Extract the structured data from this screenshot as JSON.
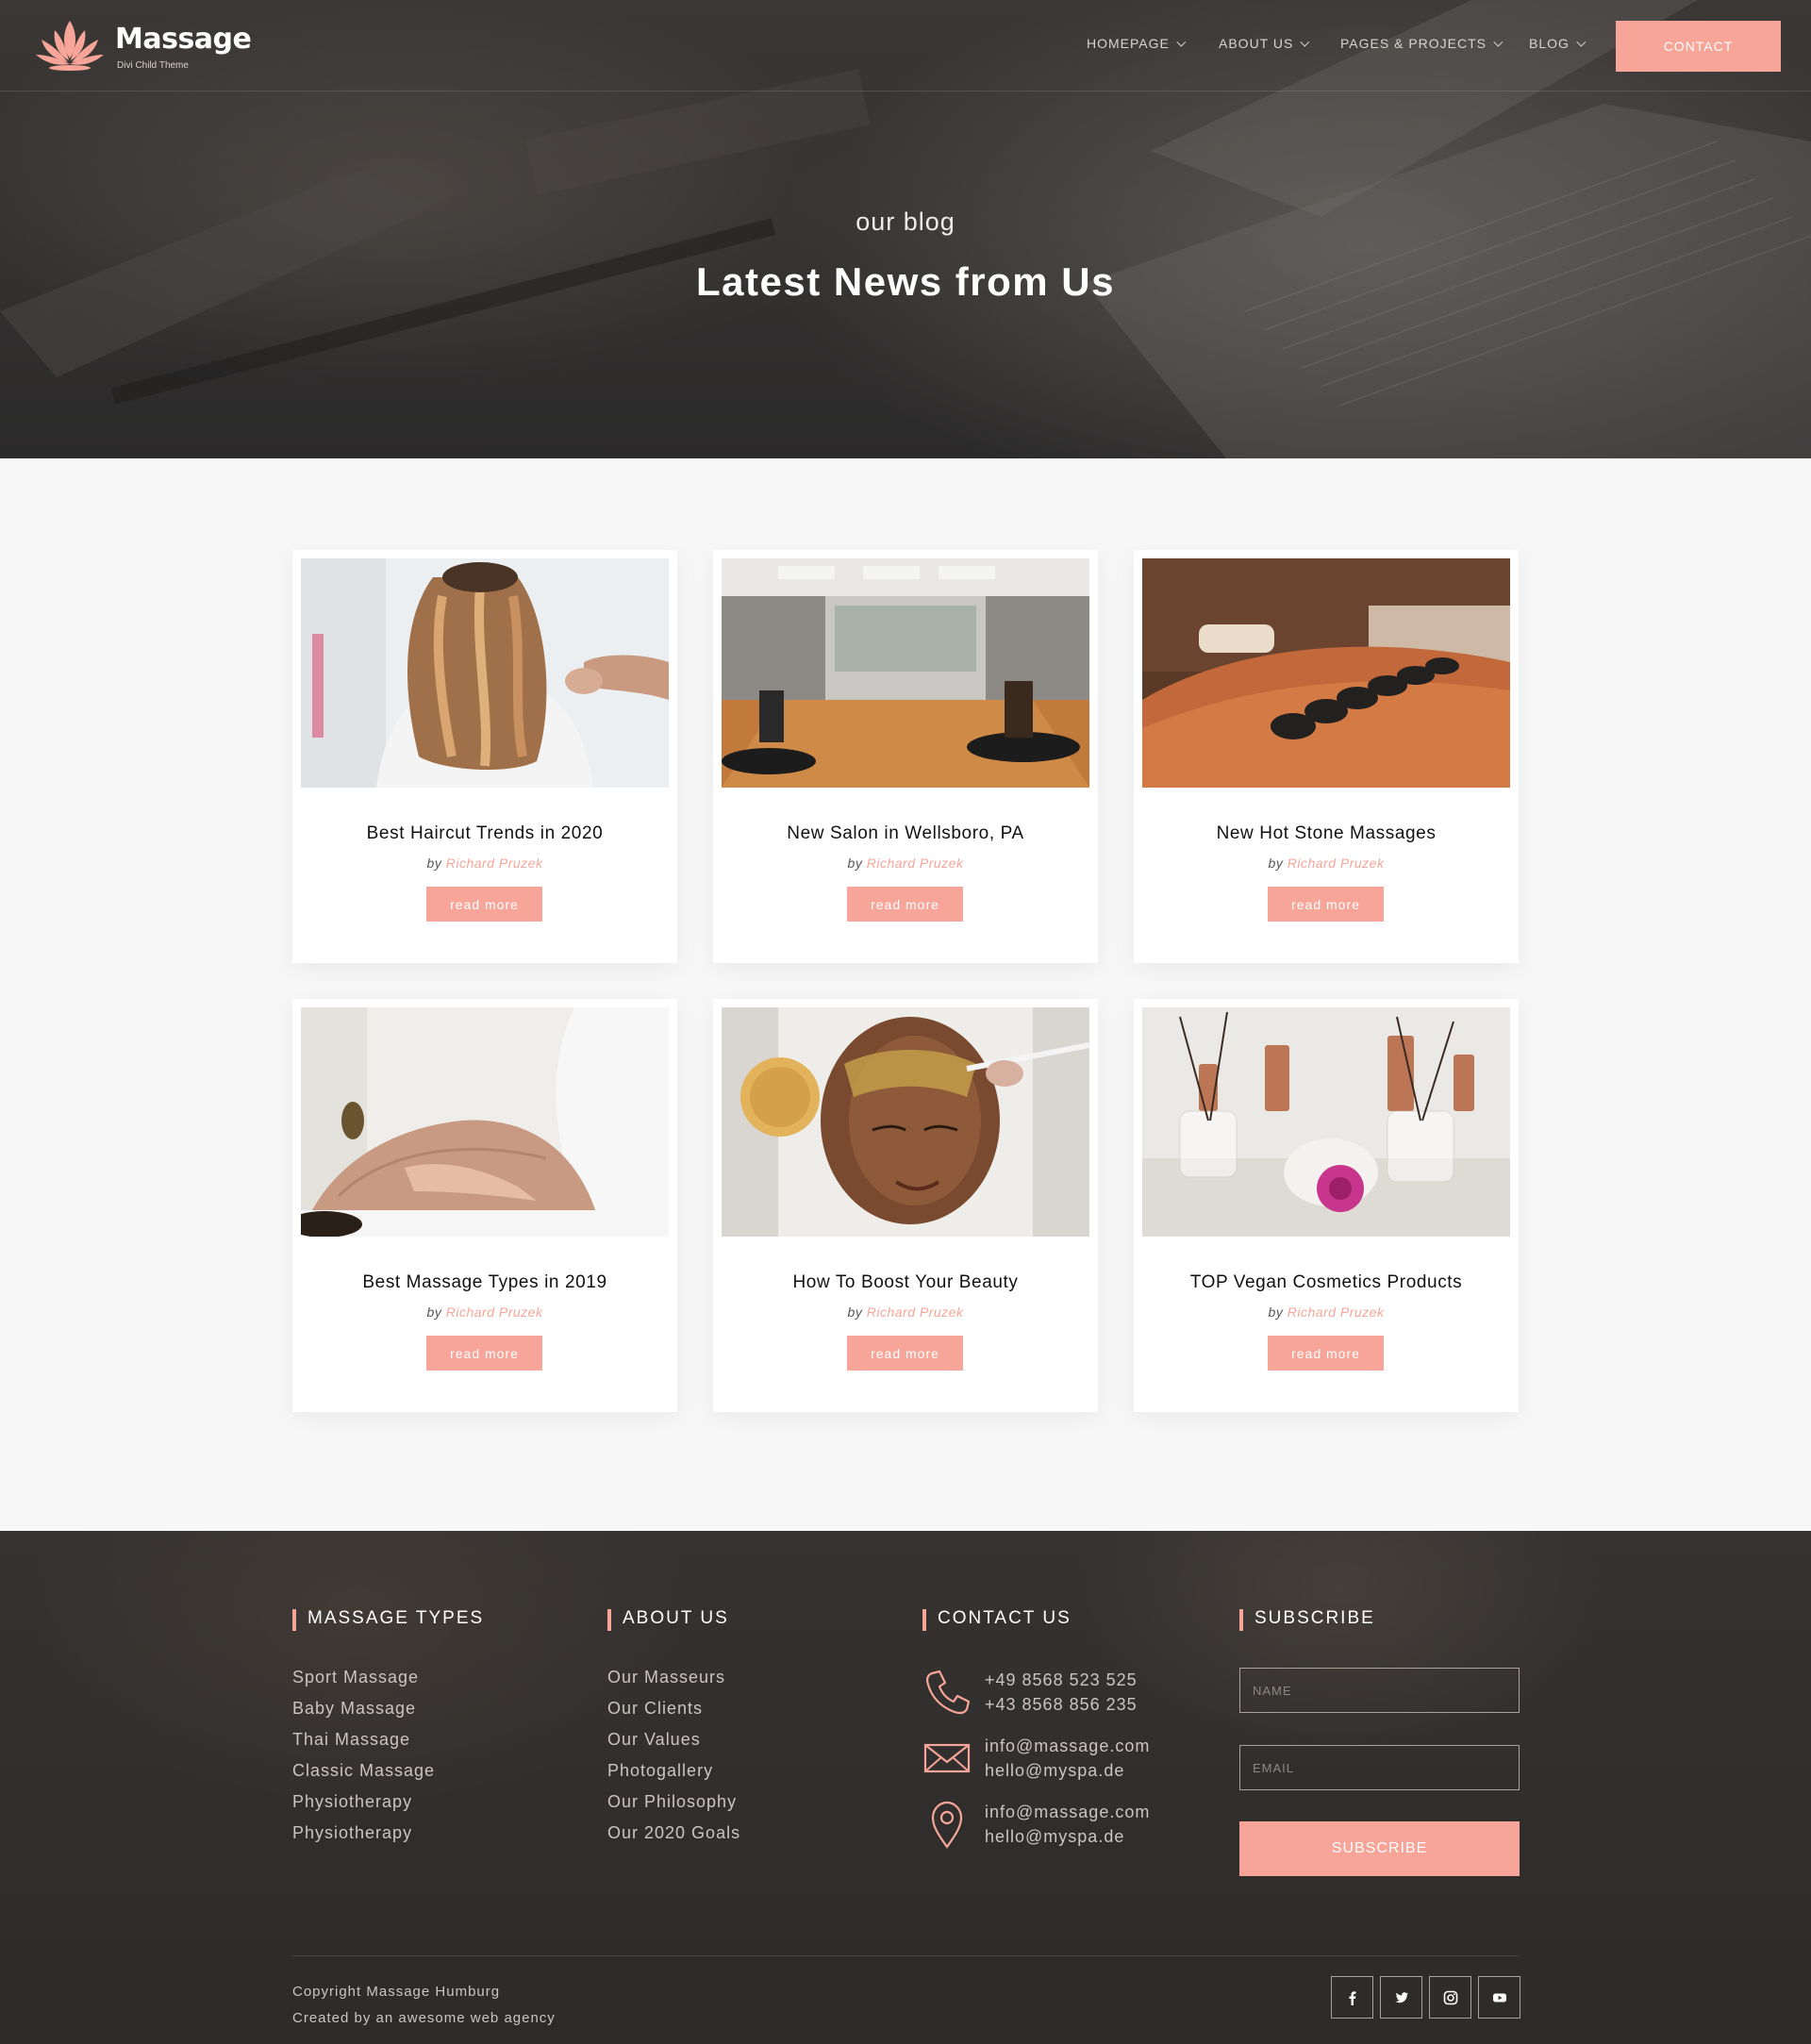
{
  "brand": {
    "name": "Massage",
    "tagline": "Divi Child Theme",
    "accent": "#f6a598"
  },
  "nav": {
    "items": [
      {
        "label": "HOMEPAGE"
      },
      {
        "label": "ABOUT US"
      },
      {
        "label": "PAGES & PROJECTS"
      },
      {
        "label": "BLOG"
      }
    ],
    "contact_label": "CONTACT"
  },
  "hero": {
    "kicker": "our blog",
    "title": "Latest News from Us"
  },
  "posts": [
    {
      "title": "Best Haircut Trends in 2020",
      "by": "by",
      "author": "Richard Pruzek",
      "button": "read more",
      "image": "haircut-photo"
    },
    {
      "title": "New Salon in Wellsboro, PA",
      "by": "by",
      "author": "Richard Pruzek",
      "button": "read more",
      "image": "salon-interior-photo"
    },
    {
      "title": "New Hot Stone Massages",
      "by": "by",
      "author": "Richard Pruzek",
      "button": "read more",
      "image": "hot-stone-photo"
    },
    {
      "title": "Best Massage Types in 2019",
      "by": "by",
      "author": "Richard Pruzek",
      "button": "read more",
      "image": "massage-photo"
    },
    {
      "title": "How To Boost Your Beauty",
      "by": "by",
      "author": "Richard Pruzek",
      "button": "read more",
      "image": "facial-mask-photo"
    },
    {
      "title": "TOP Vegan Cosmetics Products",
      "by": "by",
      "author": "Richard Pruzek",
      "button": "read more",
      "image": "cosmetics-photo"
    }
  ],
  "footer": {
    "massage_types": {
      "title": "MASSAGE TYPES",
      "links": [
        "Sport Massage",
        "Baby Massage",
        "Thai Massage",
        "Classic Massage",
        "Physiotherapy",
        "Physiotherapy"
      ]
    },
    "about_us": {
      "title": "ABOUT US",
      "links": [
        "Our Masseurs",
        "Our Clients",
        "Our Values",
        "Photogallery",
        "Our Philosophy",
        "Our 2020 Goals"
      ]
    },
    "contact_us": {
      "title": "CONTACT US",
      "phone": [
        "+49 8568 523 525",
        "+43 8568 856 235"
      ],
      "email": [
        "info@massage.com",
        "hello@myspa.de"
      ],
      "location": [
        "info@massage.com",
        "hello@myspa.de"
      ]
    },
    "subscribe": {
      "title": "SUBSCRIBE",
      "name_placeholder": "NAME",
      "email_placeholder": "EMAIL",
      "button": "SUBSCRIBE"
    },
    "copyright": [
      "Copyright Massage Humburg",
      "Created by an awesome web agency"
    ],
    "social": [
      "facebook-icon",
      "twitter-icon",
      "instagram-icon",
      "youtube-icon"
    ]
  }
}
